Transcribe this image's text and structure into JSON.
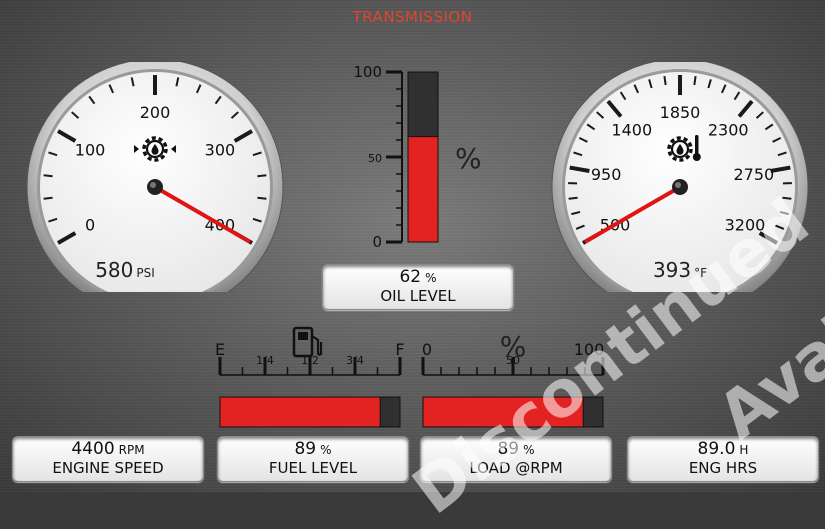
{
  "screen": {
    "title": "TRANSMISSION"
  },
  "pressure_gauge": {
    "ticks": [
      "0",
      "100",
      "200",
      "300",
      "400"
    ],
    "value": "580",
    "unit": "PSI",
    "icon": "transmission-pressure-icon",
    "needle_fraction": 1.0
  },
  "temp_gauge": {
    "ticks": [
      "500",
      "950",
      "1400",
      "1850",
      "2300",
      "2750",
      "3200"
    ],
    "value": "393",
    "unit": "°F",
    "icon": "transmission-temperature-icon",
    "needle_fraction": 0.0
  },
  "oil_bar": {
    "ticks": [
      "0",
      "50",
      "100"
    ],
    "unit": "%",
    "level": 62
  },
  "fuel_bar": {
    "ticks": [
      "E",
      "1/4",
      "1/2",
      "3/4",
      "F"
    ],
    "icon": "fuel-pump-icon",
    "level": 89
  },
  "load_bar": {
    "ticks": [
      "0",
      "50",
      "100"
    ],
    "unit": "%",
    "level": 89
  },
  "readouts": {
    "oil": {
      "value": "62",
      "unit": "%",
      "label": "OIL LEVEL"
    },
    "engine_speed": {
      "value": "4400",
      "unit": "RPM",
      "label": "ENGINE SPEED"
    },
    "fuel": {
      "value": "89",
      "unit": "%",
      "label": "FUEL LEVEL"
    },
    "load": {
      "value": "89",
      "unit": "%",
      "label": "LOAD @RPM"
    },
    "eng_hrs": {
      "value": "89.0",
      "unit": "H",
      "label": "ENG HRS"
    }
  },
  "watermark": {
    "text": "Discontinued",
    "text2": "Avai"
  },
  "colors": {
    "accent": "#e0452d",
    "bar_fill": "#e32222",
    "bar_empty": "#303030"
  }
}
